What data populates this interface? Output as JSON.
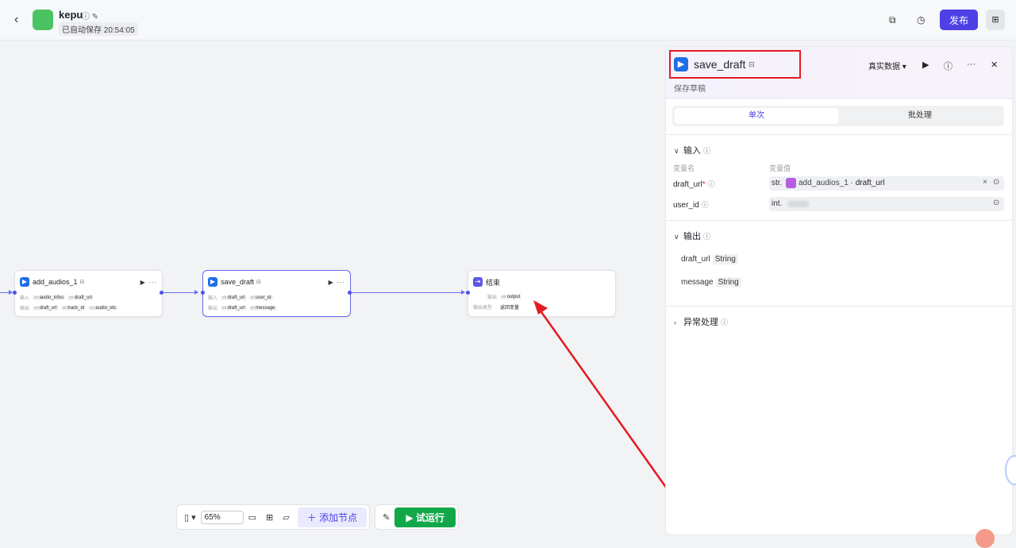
{
  "header": {
    "back_icon": "chevron-left-icon",
    "app_name": "kepu",
    "autosave": "已自动保存 20:54:05",
    "publish_label": "发布",
    "accent": "#4e40e5"
  },
  "nodes": {
    "add_audios": {
      "title": "add_audios_1",
      "input_label": "输入",
      "output_label": "输出",
      "inputs": [
        "audio_infos",
        "draft_url"
      ],
      "input_types": [
        "str",
        "str"
      ],
      "outputs": [
        "draft_url",
        "track_id",
        "audio_ids"
      ],
      "output_types": [
        "str",
        "str",
        "arr"
      ]
    },
    "save_draft": {
      "title": "save_draft",
      "input_label": "输入",
      "output_label": "输出",
      "inputs": [
        "draft_url",
        "user_id"
      ],
      "input_types": [
        "str",
        "int"
      ],
      "outputs": [
        "draft_url",
        "message"
      ],
      "output_types": [
        "str",
        "str"
      ]
    },
    "end": {
      "title": "结束",
      "output_label": "输出",
      "output_var": "output",
      "output_var_type": "str",
      "output_type_label": "输出类型",
      "output_type_value": "返回变量"
    }
  },
  "toolbar": {
    "zoom": "65%",
    "add_node": "添加节点",
    "test_run": "试运行"
  },
  "panel": {
    "title": "save_draft",
    "subtitle": "保存草稿",
    "data_mode": "真实数据 ▾",
    "tabs": [
      "单次",
      "批处理"
    ],
    "input_section": "输入",
    "col_name": "变量名",
    "col_value": "变量值",
    "params": [
      {
        "name": "draft_url",
        "required": "*",
        "type": "str.",
        "ref_node": "add_audios_1",
        "ref_sep": " · ",
        "ref_var": "draft_url"
      },
      {
        "name": "user_id",
        "type": "int."
      }
    ],
    "output_section": "输出",
    "outputs": [
      {
        "name": "draft_url",
        "type": "String"
      },
      {
        "name": "message",
        "type": "String"
      }
    ],
    "exception_section": "异常处理"
  }
}
